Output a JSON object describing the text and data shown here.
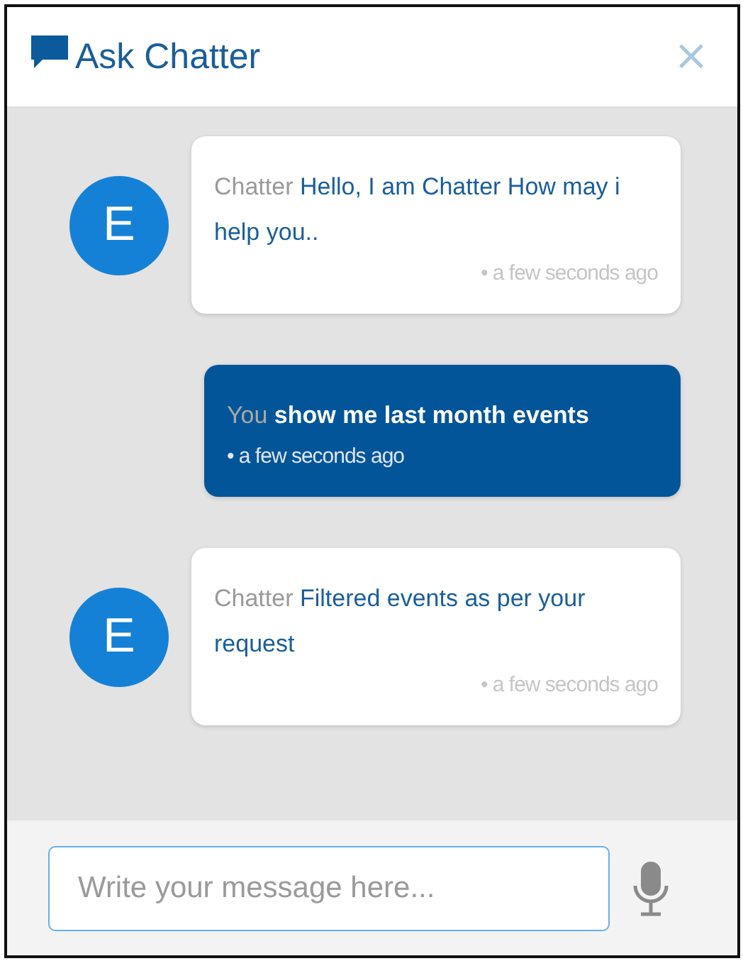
{
  "window": {
    "title": "Ask Chatter",
    "close": "×"
  },
  "messages": [
    {
      "kind": "bot",
      "avatar": "E",
      "sender": "Chatter",
      "text": "Hello, I am  Chatter  How may i help you..",
      "time": "• a few seconds ago"
    },
    {
      "kind": "user",
      "sender": "You",
      "text": "show me last month events",
      "time": "• a few seconds ago"
    },
    {
      "kind": "bot",
      "avatar": "E",
      "sender": "Chatter",
      "text": "Filtered events as per your request",
      "time": "• a few seconds ago"
    }
  ],
  "composer": {
    "placeholder": "Write your message here..."
  }
}
